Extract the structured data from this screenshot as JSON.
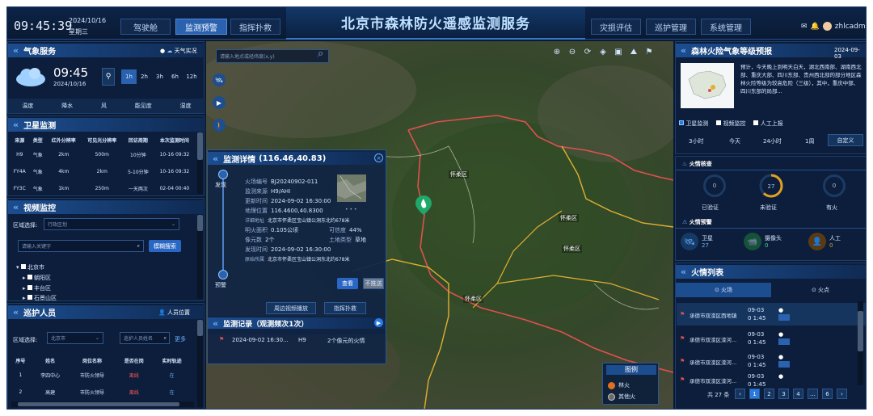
{
  "header": {
    "clock": "09:45:39",
    "date": "2024/10/16",
    "weekday": "星期三",
    "title": "北京市森林防火遥感监测服务",
    "nav_left": [
      "驾驶舱",
      "监测预警",
      "指挥扑救"
    ],
    "nav_right": [
      "灾损评估",
      "巡护管理",
      "系统管理"
    ],
    "user": "zhlcadmin"
  },
  "weather": {
    "title": "气象服务",
    "toggle_label": "天气实况",
    "time": "09:45",
    "date": "2024/10/16",
    "ranges": [
      "1h",
      "2h",
      "3h",
      "6h",
      "12h"
    ],
    "metrics": [
      "温度",
      "降水",
      "风",
      "能见度",
      "湿度"
    ]
  },
  "satellite": {
    "title": "卫星监测",
    "columns": [
      "来源",
      "类型",
      "红外分辨率",
      "可见光分辨率",
      "回访周期",
      "本次监测时间"
    ],
    "rows": [
      [
        "H9",
        "气象",
        "2km",
        "500m",
        "10分钟",
        "10-16 09:32"
      ],
      [
        "FY4A",
        "气象",
        "4km",
        "2km",
        "5-10分钟",
        "10-16 09:32"
      ],
      [
        "FY3C",
        "气象",
        "1km",
        "250m",
        "一天两次",
        "02-04 00:40"
      ]
    ]
  },
  "video": {
    "title": "视频监控",
    "region_label": "区域选择:",
    "region_placeholder": "行政区划",
    "keyword_placeholder": "请输入关键字",
    "search_button": "模糊搜索",
    "tree_root": "北京市",
    "tree_items": [
      "朝阳区",
      "丰台区",
      "石景山区"
    ]
  },
  "patrol": {
    "title": "巡护人员",
    "location_label": "人员位置",
    "region_label": "区域选择:",
    "region_value": "北京市",
    "name_placeholder": "巡护人员姓名",
    "more": "更多",
    "columns": [
      "序号",
      "姓名",
      "岗位名称",
      "是否在岗",
      "实时轨迹"
    ],
    "rows": [
      [
        "1",
        "李四中心",
        "市防火领导",
        "离线",
        "在"
      ],
      [
        "2",
        "高建",
        "市防火领导",
        "离线",
        "在"
      ]
    ]
  },
  "map": {
    "search_placeholder": "请输入地点或经纬度(x,y)",
    "place_labels": [
      "怀柔区",
      "怀柔区",
      "怀柔区",
      "怀柔区"
    ],
    "legend_title": "图例",
    "legend_items": [
      "林火",
      "其他火"
    ]
  },
  "detail": {
    "title": "监测详情",
    "coords": "(116.46,40.83)",
    "stage_start": "发现",
    "stage_end": "预警",
    "fields": [
      {
        "label": "火场编号",
        "value": "BJ20240902-011"
      },
      {
        "label": "监测来源",
        "value": "H9/AHI"
      },
      {
        "label": "更新时间",
        "value": "2024-09-02 16:30:00"
      },
      {
        "label": "地理位置",
        "value": "116.4600,40.8300"
      },
      {
        "label": "详细地址",
        "value": "北京市怀柔区宝山镇公洞东北约678米"
      },
      {
        "label": "明火面积",
        "value": "0.105公顷"
      },
      {
        "label": "像元数",
        "value": "2个"
      },
      {
        "label": "发现时间",
        "value": "2024-09-02 16:30:00"
      },
      {
        "label": "原始所属",
        "value": "北京市怀柔区宝山镇公洞东北约678米"
      }
    ],
    "extra": [
      {
        "label": "可信度",
        "value": "44%"
      },
      {
        "label": "土地类型",
        "value": "草地"
      }
    ],
    "confirm": "查看",
    "dismiss": "不推送",
    "action1": "周边视频播放",
    "action2": "指挥扑救",
    "records_title": "监测记录（观测频次1次）",
    "record": {
      "time": "2024-09-02 16:30...",
      "source": "H9",
      "desc": "2个像元的火情"
    }
  },
  "forecast": {
    "title": "森林火险气象等级预报",
    "date": "2024-09-03",
    "text": "预计，今天晚上到明天白天，湖北西南部、湖南西北部、重庆大部、四川东部、贵州西北部的部分地区森林火险等级为较高危险（三级），其中，重庆中部、四川东部的局部...",
    "filters": [
      "卫星监测",
      "视频监控",
      "人工上报"
    ],
    "time_tabs": [
      "3小时",
      "今天",
      "24小时",
      "1周",
      "自定义"
    ]
  },
  "verify": {
    "title": "火情核查",
    "items": [
      {
        "label": "已验证",
        "value": "0"
      },
      {
        "label": "未验证",
        "value": "27"
      },
      {
        "label": "有火",
        "value": "0"
      }
    ],
    "progress_unverified": 1.0
  },
  "warning": {
    "title": "火情预警",
    "items": [
      {
        "label": "卫星",
        "value": "27"
      },
      {
        "label": "摄像头",
        "value": "0"
      },
      {
        "label": "人工",
        "value": "0"
      }
    ]
  },
  "firelist": {
    "title": "火情列表",
    "tabs": [
      "火场",
      "火点"
    ],
    "rows": [
      {
        "name": "承德市双滦区西地镇",
        "time": "09-03 0 1:45"
      },
      {
        "name": "承德市双滦区滦河...",
        "time": "09-03 0 1:45"
      },
      {
        "name": "承德市双滦区滦河...",
        "time": "09-03 0 1:45"
      },
      {
        "name": "承德市双滦区滦河...",
        "time": "09-03 0 1:45"
      }
    ],
    "total": "共 27 条",
    "pages": [
      "1",
      "2",
      "3",
      "4",
      "...",
      "6"
    ]
  },
  "colors": {
    "accent": "#2a7be0",
    "border": "#e05050",
    "route": "#e0b030",
    "warning": "#e0a020"
  }
}
